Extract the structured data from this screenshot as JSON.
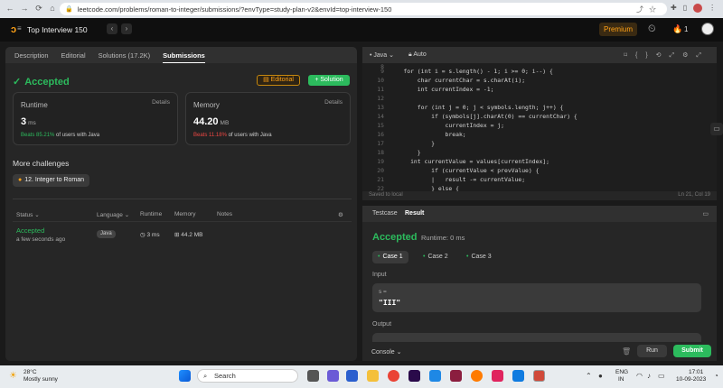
{
  "browser": {
    "url": "leetcode.com/problems/roman-to-integer/submissions/?envType=study-plan-v2&envId=top-interview-150"
  },
  "topbar": {
    "study_plan": "Top Interview 150",
    "premium": "Premium",
    "streak": "1"
  },
  "left_tabs": [
    "Description",
    "Editorial",
    "Solutions (17.2K)",
    "Submissions"
  ],
  "result": {
    "status": "Accepted",
    "editorial_button": "Editorial",
    "solution_button": "+ Solution"
  },
  "runtime_card": {
    "title": "Runtime",
    "details": "Details",
    "value": "3",
    "unit": "ms",
    "beats_pct": "Beats 85.21%",
    "beats_rest": " of users with Java"
  },
  "memory_card": {
    "title": "Memory",
    "details": "Details",
    "value": "44.20",
    "unit": "MB",
    "beats_pct": "Beats 11.18%",
    "beats_rest": " of users with Java"
  },
  "challenges": {
    "heading": "More challenges",
    "item": "12. Integer to Roman"
  },
  "table": {
    "headers": [
      "Status",
      "Language",
      "Runtime",
      "Memory",
      "Notes"
    ],
    "row": {
      "status": "Accepted",
      "time": "a few seconds ago",
      "language": "Java",
      "runtime": "3 ms",
      "memory": "44.2 MB"
    }
  },
  "editor": {
    "language": "Java",
    "mode": "Auto",
    "saved": "Saved to local",
    "position": "Ln 21, Col 19",
    "lines": [
      {
        "n": "8",
        "t": ""
      },
      {
        "n": "9",
        "t": "    for (int i = s.length() - 1; i >= 0; i--) {"
      },
      {
        "n": "10",
        "t": "        char currentChar = s.charAt(i);"
      },
      {
        "n": "11",
        "t": "        int currentIndex = -1;"
      },
      {
        "n": "12",
        "t": ""
      },
      {
        "n": "13",
        "t": "        for (int j = 0; j < symbols.length; j++) {"
      },
      {
        "n": "14",
        "t": "            if (symbols[j].charAt(0) == currentChar) {"
      },
      {
        "n": "15",
        "t": "                currentIndex = j;"
      },
      {
        "n": "16",
        "t": "                break;"
      },
      {
        "n": "17",
        "t": "            }"
      },
      {
        "n": "18",
        "t": "        }"
      },
      {
        "n": "19",
        "t": "      int currentValue = values[currentIndex];"
      },
      {
        "n": "20",
        "t": "            if (currentValue < prevValue) {"
      },
      {
        "n": "21",
        "t": "            |   result -= currentValue;"
      },
      {
        "n": "22",
        "t": "            } else {"
      }
    ]
  },
  "testpanel": {
    "tabs": [
      "Testcase",
      "Result"
    ],
    "status": "Accepted",
    "runtime": "Runtime: 0 ms",
    "cases": [
      "Case 1",
      "Case 2",
      "Case 3"
    ],
    "input_label": "Input",
    "input_var": "s =",
    "input_value": "\"III\"",
    "output_label": "Output",
    "console": "Console",
    "run": "Run",
    "submit": "Submit"
  },
  "taskbar": {
    "temp": "28°C",
    "weather": "Mostly sunny",
    "search": "Search",
    "lang1": "ENG",
    "lang2": "IN",
    "time": "17:01",
    "date": "10-09-2023"
  }
}
